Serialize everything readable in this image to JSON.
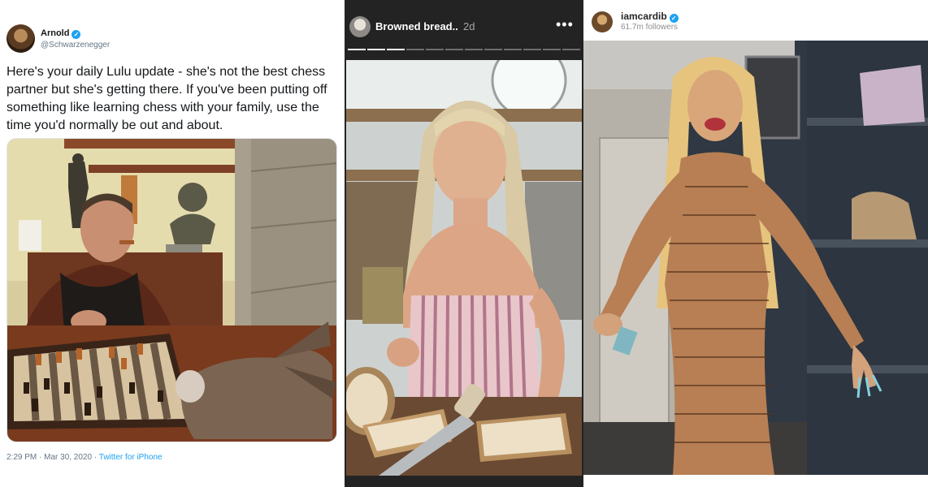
{
  "tweet": {
    "display_name": "Arnold",
    "handle": "@Schwarzenegger",
    "text": "Here's your daily Lulu update - she's not the best chess partner but she's getting there. If you've been putting off something like learning chess with your family, use the time you'd normally be out and about.",
    "time": "2:29 PM · Mar 30, 2020 · ",
    "source": "Twitter for iPhone"
  },
  "story": {
    "title": "Browned bread..",
    "age": "2d",
    "more_icon": "more-dots-icon",
    "segments_total": 12,
    "segments_done": 3
  },
  "reel": {
    "username": "iamcardib",
    "followers": "61.7m followers"
  },
  "colors": {
    "twitter_blue": "#1da1f2",
    "story_bg": "#232323"
  }
}
